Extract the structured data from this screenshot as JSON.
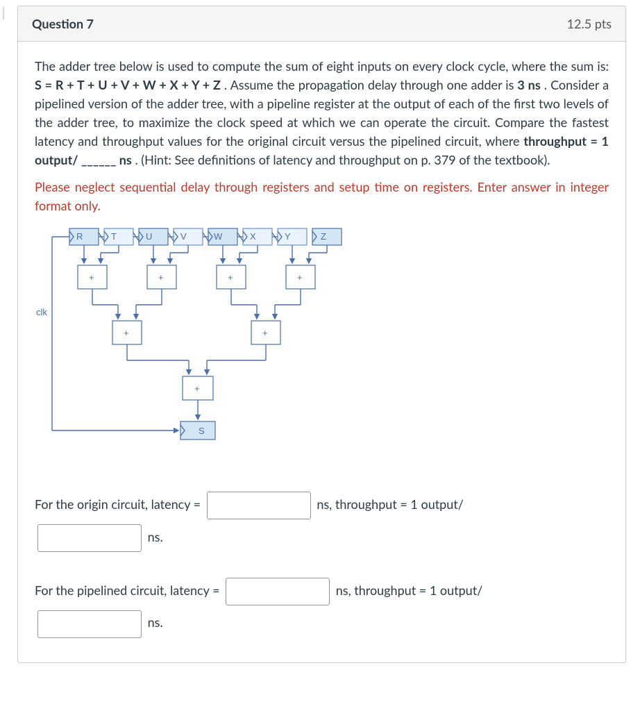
{
  "header": {
    "title": "Question 7",
    "points": "12.5 pts"
  },
  "body": {
    "p1a": "The adder tree below is used to compute the sum of eight inputs on every clock cycle, where the sum is: ",
    "formula": "S = R + T + U + V + W + X + Y + Z",
    "p1b": ". Assume the propagation delay through one adder is ",
    "delay": "3 ns",
    "p1c": ". Consider a pipelined version of the adder tree, with a pipeline register at the output of each of the first two levels of the adder tree, to maximize the clock speed at which we can operate the circuit. Compare the fastest latency and throughput values for the original circuit versus the pipelined circuit, where ",
    "thr": "throughput = 1 output/ ______ ns",
    "p1d": ". (Hint: See definitions of latency and throughput on p. 379 of the textbook).",
    "redline": "Please neglect sequential delay through registers and setup time on registers. Enter answer in integer format only."
  },
  "diagram": {
    "regs": [
      "R",
      "T",
      "U",
      "V",
      "W",
      "X",
      "Y",
      "Z"
    ],
    "clk": "clk",
    "plus": "+",
    "out": "S"
  },
  "answers": {
    "origin_a": "For the origin circuit, latency = ",
    "origin_b": " ns, throughput = 1 output/ ",
    "origin_c": " ns.",
    "pipe_a": "For the pipelined circuit, latency = ",
    "pipe_b": " ns, throughput = 1 output/ ",
    "pipe_c": " ns."
  }
}
